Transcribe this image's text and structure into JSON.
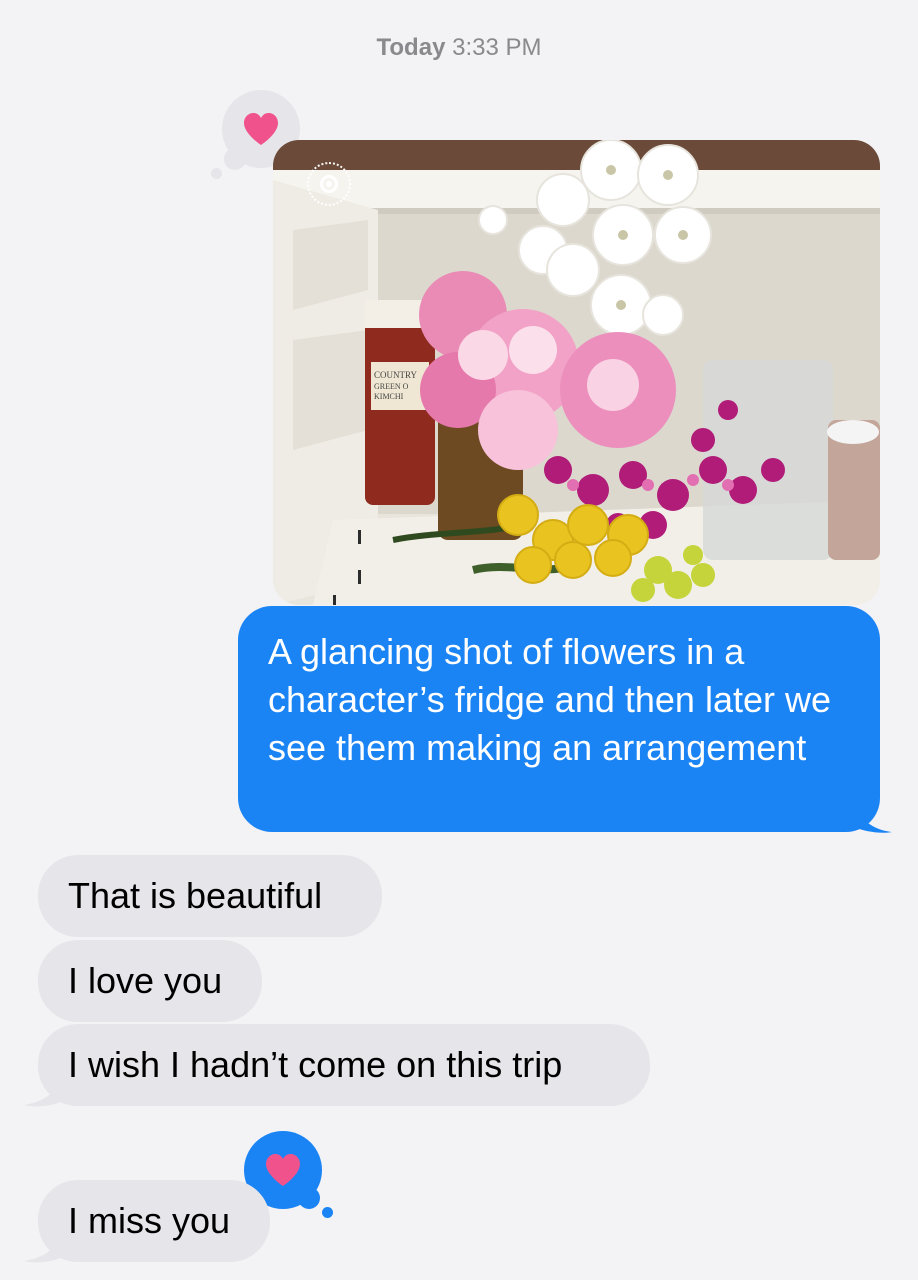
{
  "header": {
    "timestamp_day": "Today",
    "timestamp_time": "3:33 PM"
  },
  "tapbacks": [
    {
      "icon": "heart-icon",
      "color": "#f0538c",
      "bubble": "gray"
    },
    {
      "icon": "heart-icon",
      "color": "#f0538c",
      "bubble": "blue"
    }
  ],
  "photo": {
    "subject": "flowers in fridge",
    "live_badge_icon": "live-photo-icon",
    "jar_label": "COUNTRY GREEN ONION KIMCHI"
  },
  "messages": [
    {
      "direction": "sent",
      "text": "A glancing shot of flowers in a character’s fridge and then later we see them making an arrangement"
    },
    {
      "direction": "received",
      "text": "That is beautiful"
    },
    {
      "direction": "received",
      "text": "I love you"
    },
    {
      "direction": "received",
      "text": "I wish I hadn’t come on this trip"
    },
    {
      "direction": "received",
      "text": "I miss you"
    }
  ],
  "colors": {
    "sent_bubble": "#1b84f5",
    "received_bubble": "#e5e5ea",
    "background": "#f3f3f5",
    "heart": "#f0538c"
  }
}
